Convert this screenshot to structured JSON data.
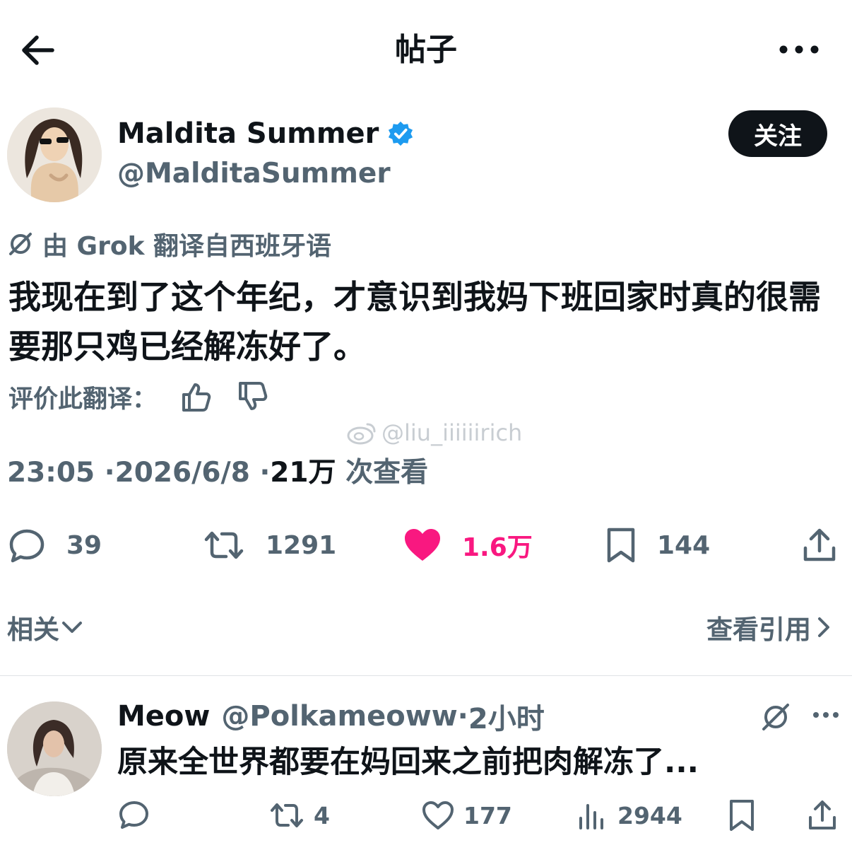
{
  "header": {
    "title": "帖子"
  },
  "author": {
    "name": "Maldita Summer",
    "handle": "@MalditaSummer",
    "follow_label": "关注"
  },
  "post": {
    "translation_note": "由 Grok 翻译自西班牙语",
    "text": "我现在到了这个年纪，才意识到我妈下班回家时真的很需要那只鸡已经解冻好了。",
    "rate_label": "评价此翻译：",
    "watermark": "@liu_iiiiiirich",
    "time": "23:05",
    "date": "2026/6/8",
    "views_count": "21万",
    "views_label": "次查看",
    "sep": "·"
  },
  "actions": {
    "replies": "39",
    "reposts": "1291",
    "likes": "1.6万",
    "bookmarks": "144"
  },
  "related": {
    "label": "相关",
    "quotes_label": "查看引用"
  },
  "reply": {
    "name": "Meow",
    "handle": "@Polkameoww",
    "sep": "·",
    "time": "2小时",
    "text": "原来全世界都要在妈回来之前把肉解冻了...",
    "reposts": "4",
    "likes": "177",
    "views": "2944"
  },
  "colors": {
    "like": "#f91880",
    "verified": "#1d9bf0",
    "secondary": "#536471"
  }
}
